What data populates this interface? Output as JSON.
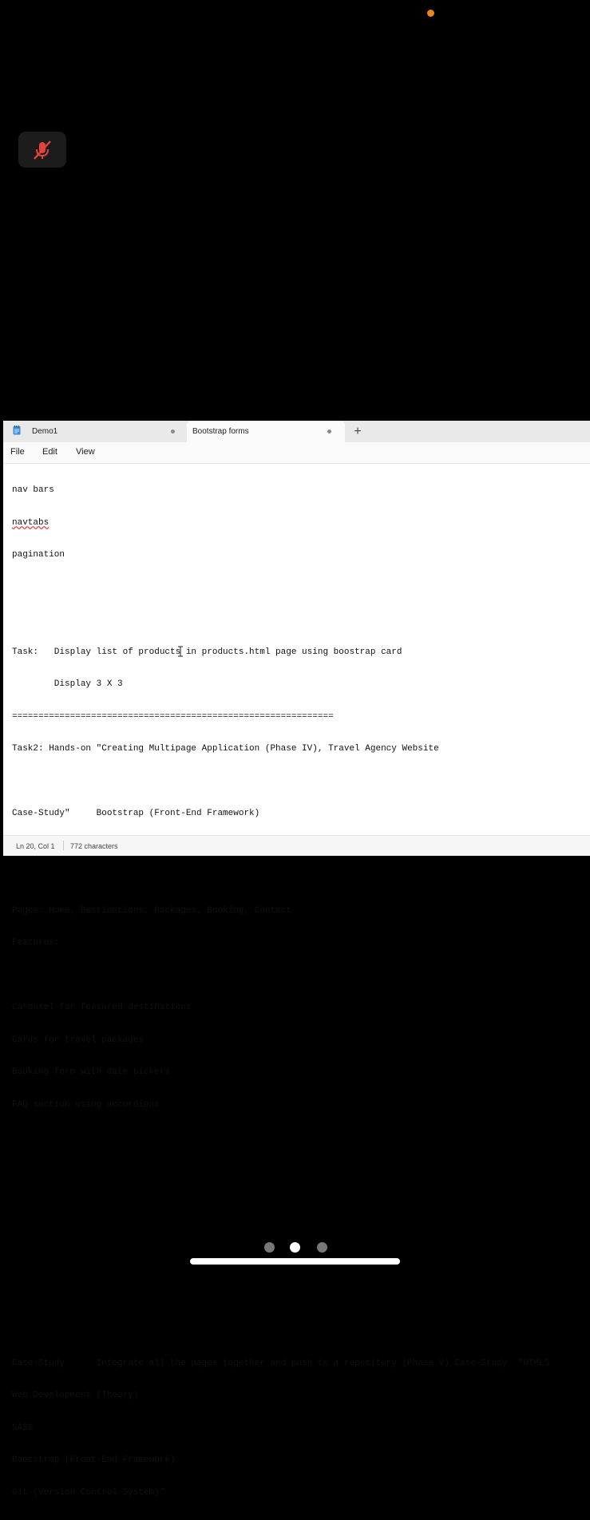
{
  "tabs": [
    {
      "label": "Demo1",
      "active": false
    },
    {
      "label": "Bootstrap forms",
      "active": true
    }
  ],
  "new_tab_label": "+",
  "menu": [
    "File",
    "Edit",
    "View"
  ],
  "lines": [
    "nav bars",
    "navtabs",
    "pagination",
    "",
    "",
    "Task:   Display list of products in products.html page using boostrap card",
    "        Display 3 X 3",
    "=============================================================",
    "Task2: Hands-on \"Creating Multipage Application (Phase IV), Travel Agency Website",
    "",
    "Case-Study\"     Bootstrap (Front-End Framework)",
    "",
    "",
    "Pages: Home, Destinations, Packages, Booking, Contact",
    "Features:",
    "",
    "Carousel for featured destinations",
    "Cards for travel packages",
    "Booking form with date pickers",
    "FAQ section using accordions",
    "",
    "",
    "",
    "",
    "",
    "",
    "",
    "Case-Study      Integrate all the pages together and push to a repository (Phase V) Case-Study  \"HTML5",
    "Web Development (Theory)",
    "SASS",
    "Bootstrap (Front-End Framework)",
    "Git (Version Control System)\""
  ],
  "status": {
    "position": "Ln 20, Col 1",
    "characters": "772 characters"
  },
  "icons": {
    "mute": "mic-muted-icon",
    "app": "notepad-icon",
    "text_cursor": "i-beam-cursor-icon"
  },
  "colors": {
    "accent_recording": "#e8871e",
    "mute_red": "#e0443a",
    "spellcheck": "#d33"
  }
}
